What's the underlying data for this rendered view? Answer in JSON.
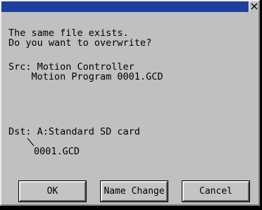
{
  "dialog": {
    "message_line1": "The same file exists.",
    "message_line2": "Do you want to overwrite?",
    "src_line1": "Src: Motion Controller",
    "src_line2": "    Motion Program 0001.GCD",
    "dst_line1": "Dst: A:Standard SD card",
    "dst_line2": "0001.GCD",
    "close_glyph": "X"
  },
  "buttons": {
    "ok": "OK",
    "name_change": "Name Change",
    "cancel": "Cancel"
  },
  "colors": {
    "titlebar": "#1f3f9f",
    "dialog_bg": "#c0c0c0"
  }
}
